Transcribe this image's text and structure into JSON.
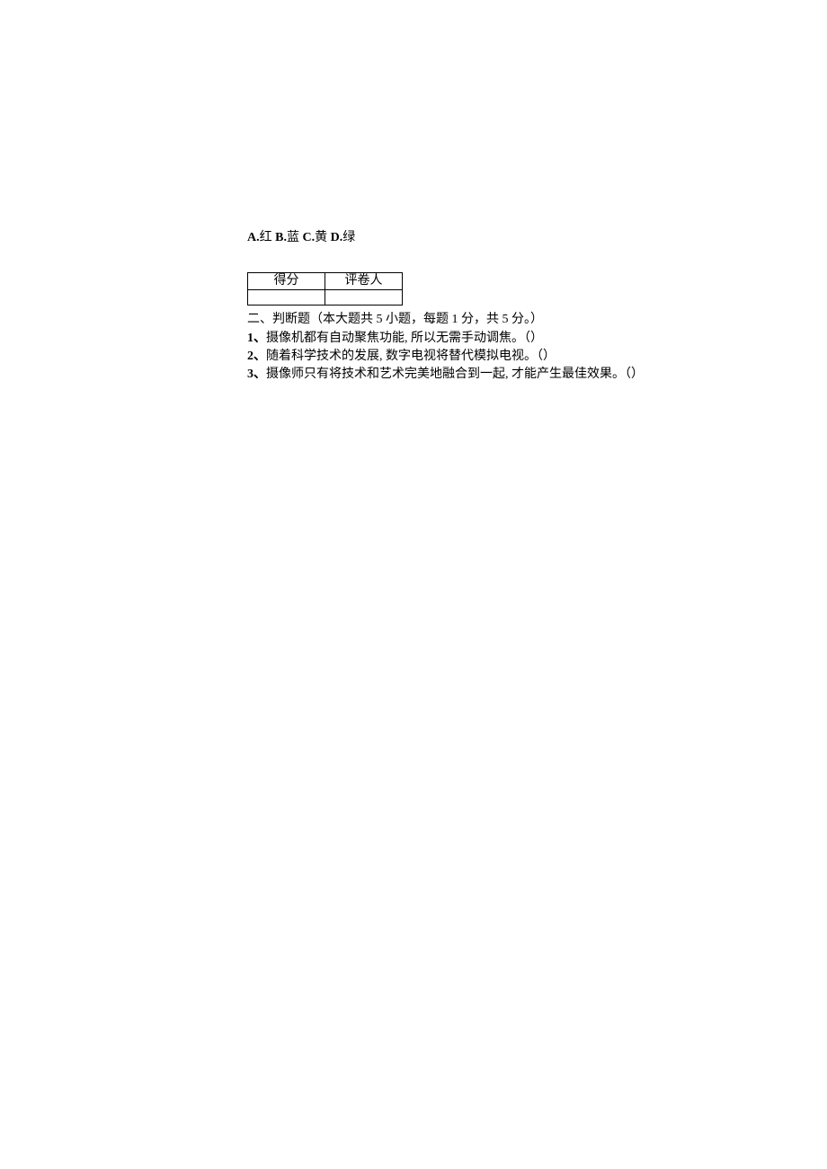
{
  "options": {
    "A_prefix": "A.",
    "A_text": "红 ",
    "B_prefix": "B.",
    "B_text": "蓝 ",
    "C_prefix": "C.",
    "C_text": "黄 ",
    "D_prefix": "D.",
    "D_text": "绿"
  },
  "score_table": {
    "header_left": "得分",
    "header_right": "评卷人"
  },
  "section": {
    "heading": "二、判断题（本大题共 5 小题，每题 1 分，共 5 分。）"
  },
  "questions": [
    {
      "num": "1",
      "sep": "、",
      "text": "摄像机都有自动聚焦功能, 所以无需手动调焦。（）"
    },
    {
      "num": "2",
      "sep": "、",
      "text": "随着科学技术的发展, 数字电视将替代模拟电视。（）"
    },
    {
      "num": "3",
      "sep": "、",
      "text": "摄像师只有将技术和艺术完美地融合到一起, 才能产生最佳效果。（）"
    }
  ]
}
